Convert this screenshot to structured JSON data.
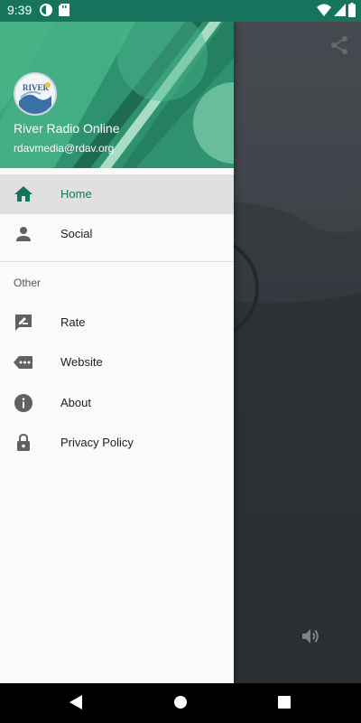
{
  "status_bar": {
    "time": "9:39"
  },
  "drawer": {
    "app_name": "River Radio Online",
    "email": "rdavmedia@rdav.org",
    "items": [
      {
        "label": "Home",
        "icon": "home-icon",
        "active": true
      },
      {
        "label": "Social",
        "icon": "person-icon",
        "active": false
      }
    ],
    "section_title": "Other",
    "other_items": [
      {
        "label": "Rate",
        "icon": "rate-review-icon"
      },
      {
        "label": "Website",
        "icon": "web-tag-icon"
      },
      {
        "label": "About",
        "icon": "info-icon"
      },
      {
        "label": "Privacy Policy",
        "icon": "lock-icon"
      }
    ]
  },
  "colors": {
    "primary": "#17735c",
    "header_green": "#3aa77d",
    "active_bg": "#e0e0e0"
  }
}
